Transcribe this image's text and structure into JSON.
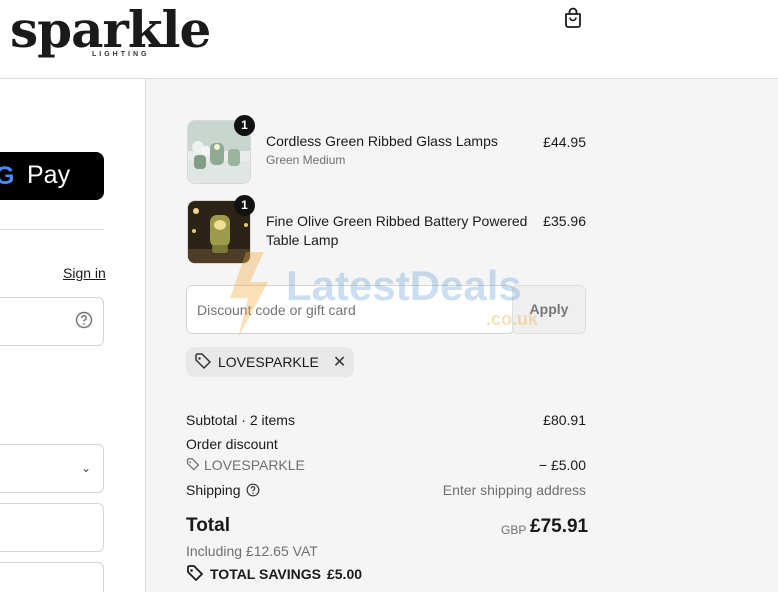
{
  "header": {
    "logo_word": "sparkle",
    "logo_sub": "LIGHTING",
    "cart_icon": "shopping-bag-icon"
  },
  "left": {
    "gpay_label": "Pay",
    "gpay_g": "G",
    "signin_label": "Sign in",
    "help_icon": "question-circle-icon",
    "dropdown_icon": "chevron-down-icon"
  },
  "order": {
    "items": [
      {
        "quantity": "1",
        "name": "Cordless Green Ribbed Glass Lamps",
        "variant": "Green Medium",
        "price": "£44.95"
      },
      {
        "quantity": "1",
        "name": "Fine Olive Green Ribbed Battery Powered Table Lamp",
        "variant": "",
        "price": "£35.96"
      }
    ],
    "discount": {
      "placeholder": "Discount code or gift card",
      "apply_label": "Apply",
      "applied_code": "LOVESPARKLE"
    },
    "summary": {
      "subtotal_label": "Subtotal · 2 items",
      "subtotal_value": "£80.91",
      "order_discount_label": "Order discount",
      "discount_code": "LOVESPARKLE",
      "discount_value": "− £5.00",
      "shipping_label": "Shipping",
      "shipping_value": "Enter shipping address",
      "total_label": "Total",
      "currency": "GBP",
      "total_value": "£75.91",
      "vat_text": "Including £12.65 VAT",
      "savings_label": "TOTAL SAVINGS",
      "savings_value": "£5.00"
    }
  },
  "watermark": {
    "text_main": "LatestDeals",
    "text_sub": ".co.uk"
  },
  "colors": {
    "accent_black": "#000000",
    "panel_bg": "#f5f5f5",
    "muted_text": "#707070",
    "watermark_blue": "#6ea3d8",
    "watermark_orange": "#f2a838"
  }
}
